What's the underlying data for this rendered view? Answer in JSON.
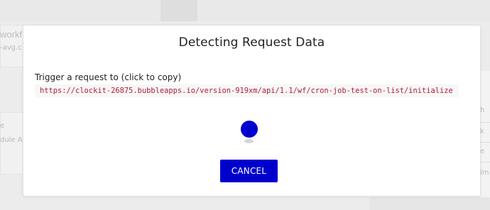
{
  "background": {
    "card1": {
      "title": "workfl",
      "subtitle": "-avg.cl"
    },
    "card2": {
      "title": "e",
      "subtitle": "dule AP"
    },
    "right_panel_items": [
      "h",
      "k",
      "e",
      "im"
    ]
  },
  "modal": {
    "title": "Detecting Request Data",
    "trigger_label": "Trigger a request to (click to copy)",
    "endpoint_url": "https://clockit-26875.bubbleapps.io/version-919xm/api/1.1/wf/cron-job-test-on-list/initialize",
    "cancel_label": "CANCEL"
  },
  "colors": {
    "accent": "#0000cd",
    "url_text": "#b01e3a",
    "loader": "#0000d0"
  },
  "icons": {
    "loader": "bouncing-ball-loader"
  }
}
